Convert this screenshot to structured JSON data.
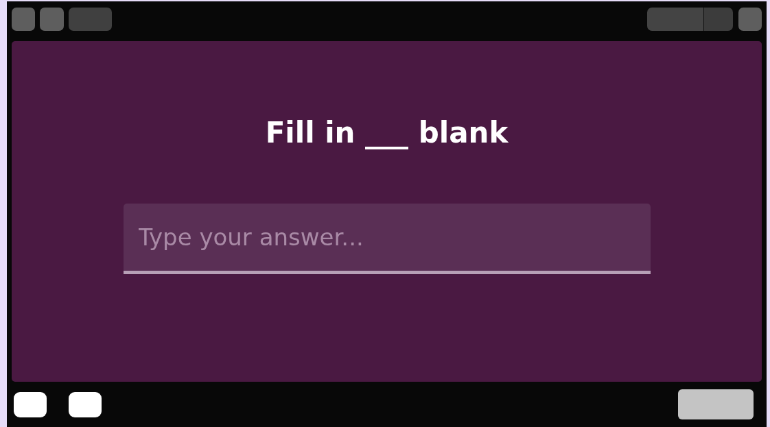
{
  "question": "Fill in ___ blank",
  "answer": {
    "placeholder": "Type your answer..."
  }
}
